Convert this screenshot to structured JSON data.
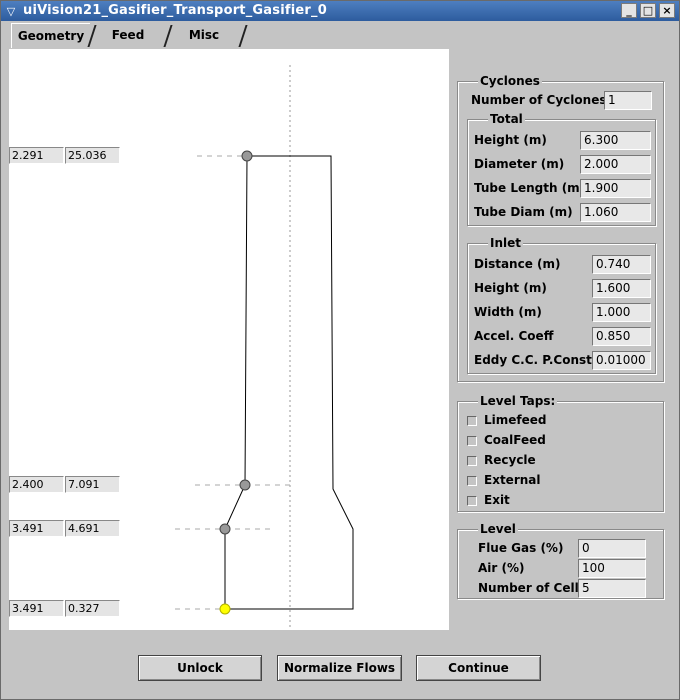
{
  "window": {
    "title": "uiVision21_Gasifier_Transport_Gasifier_0",
    "menu_glyph": "▽",
    "minimize": "_",
    "maximize": "□",
    "close": "×"
  },
  "tabs": [
    "Geometry",
    "Feed",
    "Misc"
  ],
  "active_tab": "Geometry",
  "geometry_points": [
    {
      "x": "2.291",
      "y": "25.036",
      "highlighted": false
    },
    {
      "x": "2.400",
      "y": "7.091",
      "highlighted": false
    },
    {
      "x": "3.491",
      "y": "4.691",
      "highlighted": false
    },
    {
      "x": "3.491",
      "y": "0.327",
      "highlighted": true
    }
  ],
  "cyclones": {
    "label": "Cyclones",
    "count_label": "Number of Cyclones:",
    "count": "1",
    "total": {
      "label": "Total",
      "fields": [
        {
          "label": "Height (m)",
          "value": "6.300"
        },
        {
          "label": "Diameter (m)",
          "value": "2.000"
        },
        {
          "label": "Tube Length (m)",
          "value": "1.900"
        },
        {
          "label": "Tube Diam (m)",
          "value": "1.060"
        }
      ]
    },
    "inlet": {
      "label": "Inlet",
      "fields": [
        {
          "label": "Distance (m)",
          "value": "0.740"
        },
        {
          "label": "Height (m)",
          "value": "1.600"
        },
        {
          "label": "Width (m)",
          "value": "1.000"
        },
        {
          "label": "Accel. Coeff",
          "value": "0.850"
        },
        {
          "label": "Eddy C.C. P.Const",
          "value": "0.01000"
        }
      ]
    }
  },
  "level_taps": {
    "label": "Level Taps:",
    "items": [
      {
        "label": "Limefeed",
        "checked": false
      },
      {
        "label": "CoalFeed",
        "checked": false
      },
      {
        "label": "Recycle",
        "checked": false
      },
      {
        "label": "External",
        "checked": false
      },
      {
        "label": "Exit",
        "checked": false
      }
    ]
  },
  "level": {
    "label": "Level",
    "fields": [
      {
        "label": "Flue Gas (%)",
        "value": "0"
      },
      {
        "label": "Air (%)",
        "value": "100"
      },
      {
        "label": "Number of Cells",
        "value": "5"
      }
    ]
  },
  "buttons": {
    "unlock": "Unlock",
    "normalize": "Normalize Flows",
    "continue": "Continue"
  },
  "colors": {
    "title_bar": "#3a6aad",
    "point_fill": "#999999",
    "highlight_point": "#ffff00",
    "canvas": "#ffffff"
  }
}
